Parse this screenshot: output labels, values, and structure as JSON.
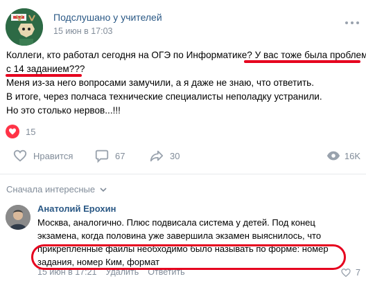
{
  "post": {
    "group_name": "Подслушано у учителей",
    "date": "15 июн в 17:03",
    "text_lines": [
      "Коллеги, кто работал сегодня на ОГЭ по Информатике? У вас тоже была проблема",
      "с 14 заданием???",
      "Меня из-за него вопросами замучили, а я даже не знаю, что ответить.",
      "В итоге, через полчаса технические специалисты неполадку устранили.",
      "Но это столько нервов...!!!"
    ],
    "reaction_count": "15",
    "actions": {
      "like_label": "Нравится",
      "comments_count": "67",
      "shares_count": "30",
      "views_count": "16K"
    }
  },
  "comments_section": {
    "sort_label": "Сначала интересные"
  },
  "comment": {
    "author": "Анатолий Ерохин",
    "text_lines": [
      "Москва, аналогично. Плюс подвисала система у детей. Под конец",
      "экзамена, когда половина уже завершила экзамен выяснилось, что",
      "прикрепленные файлы необходимо было называть по форме: номер",
      "задания, номер Ким, формат"
    ],
    "date": "15 июн в 17:21",
    "delete_label": "Удалить",
    "reply_label": "Ответить",
    "likes": "7"
  },
  "colors": {
    "link": "#2a5885",
    "secondary": "#818c99",
    "annotation_red": "#e6001e",
    "reaction_red": "#ff3347"
  },
  "icons": [
    "heart-icon",
    "comment-icon",
    "share-icon",
    "eye-icon",
    "chevron-down-icon",
    "more-icon"
  ]
}
